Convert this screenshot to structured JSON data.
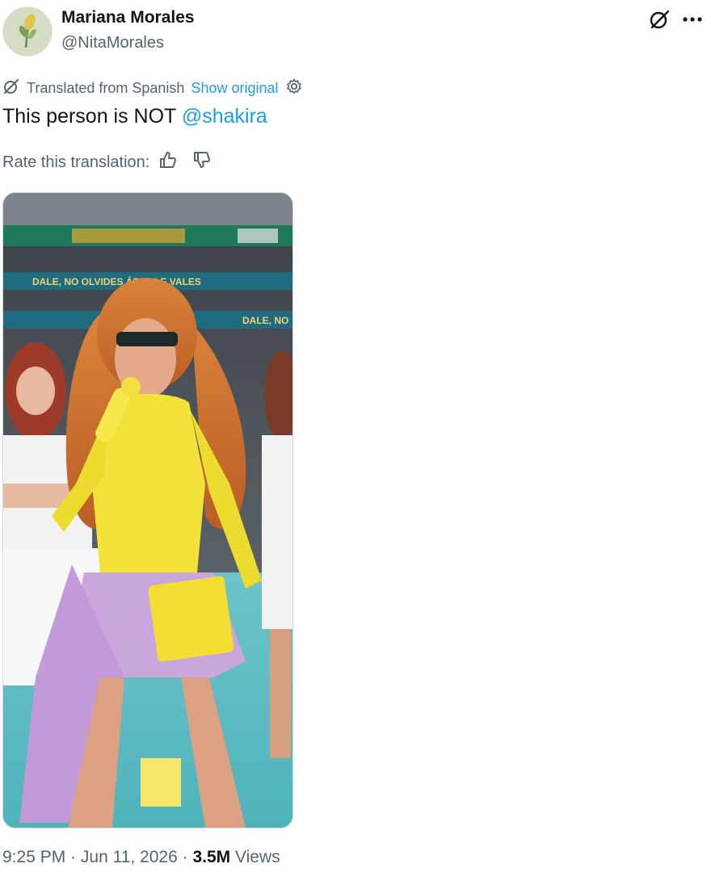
{
  "author": {
    "display_name": "Mariana Morales",
    "handle": "@NitaMorales",
    "avatar_icon": "avatar-image"
  },
  "header_icons": [
    "grok-icon",
    "more-icon"
  ],
  "translation": {
    "label": "Translated from Spanish",
    "show_original": "Show original",
    "icons": [
      "translate-icon",
      "settings-icon"
    ]
  },
  "tweet": {
    "text_prefix": "This person is NOT ",
    "mention": "@shakira"
  },
  "rating": {
    "label": "Rate this translation:",
    "icons": [
      "thumbs-up-icon",
      "thumbs-down-icon"
    ]
  },
  "media": {
    "banner_text_1": "DALE, NO OLVIDES ÁRBOLE VALES",
    "banner_text_2": "DALE, NO"
  },
  "meta": {
    "time": "9:25 PM",
    "sep1": " · ",
    "date": "Jun 11, 2026",
    "sep2": " · ",
    "views_count": "3.5M",
    "views_label": " Views"
  },
  "colors": {
    "link": "#1d9bf0",
    "secondary_text": "#536471",
    "primary_text": "#0f1419"
  }
}
